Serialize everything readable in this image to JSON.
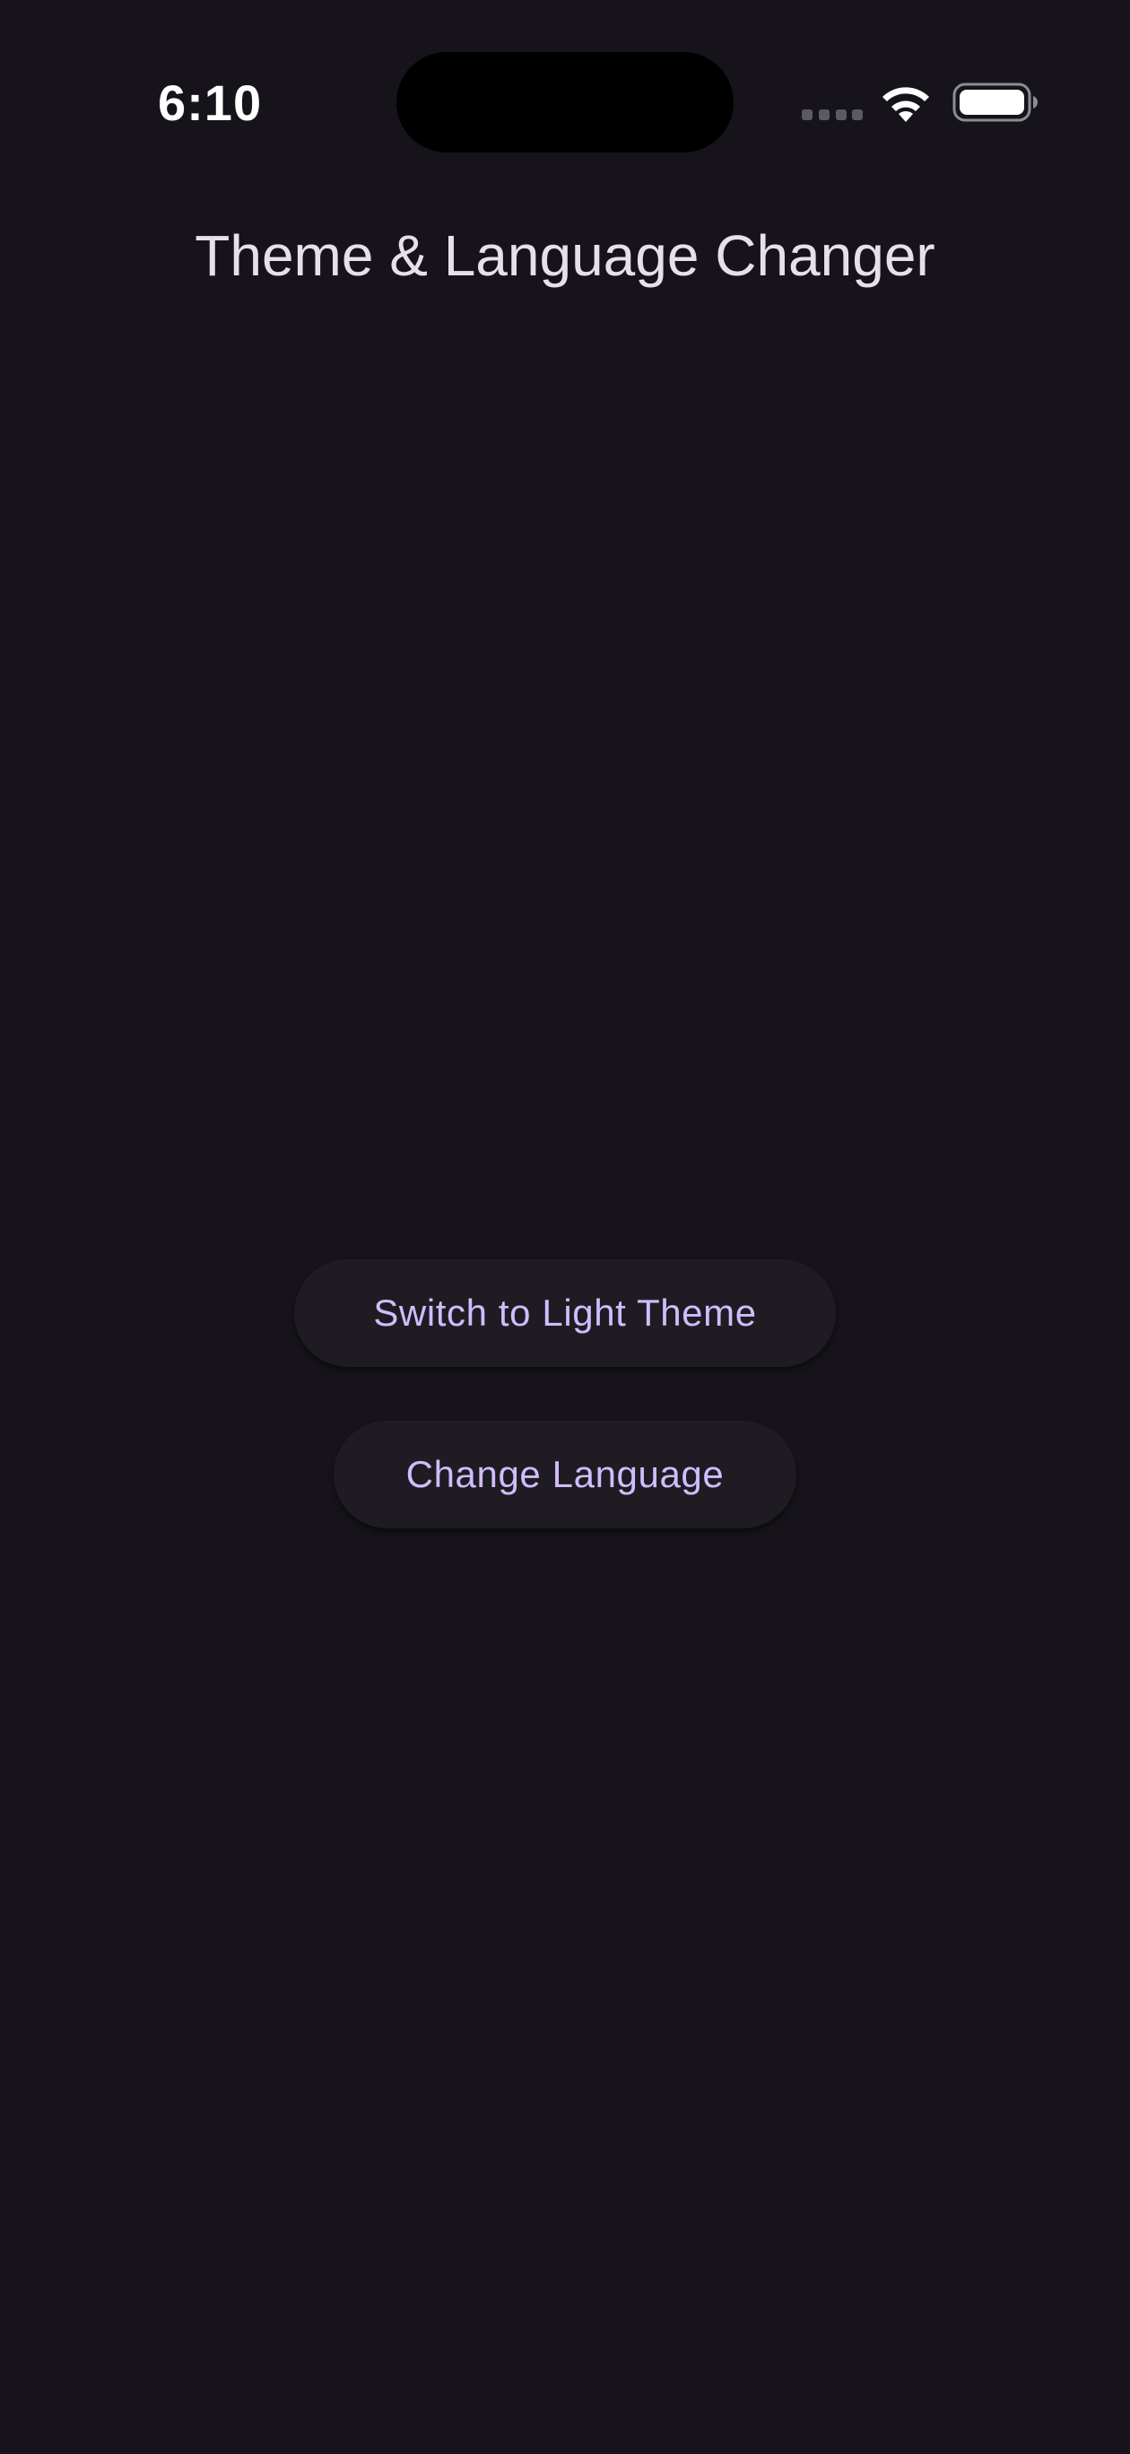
{
  "status_bar": {
    "time": "6:10",
    "icons": [
      "signal-dots-icon",
      "wifi-icon",
      "battery-icon"
    ]
  },
  "app_bar": {
    "title": "Theme & Language Changer"
  },
  "actions": {
    "theme_button_label": "Switch to Light Theme",
    "language_button_label": "Change Language"
  },
  "colors": {
    "background": "#16141a",
    "title_text": "#e6e0e9",
    "button_surface": "#1e1c22",
    "button_text": "#d0bcff"
  }
}
